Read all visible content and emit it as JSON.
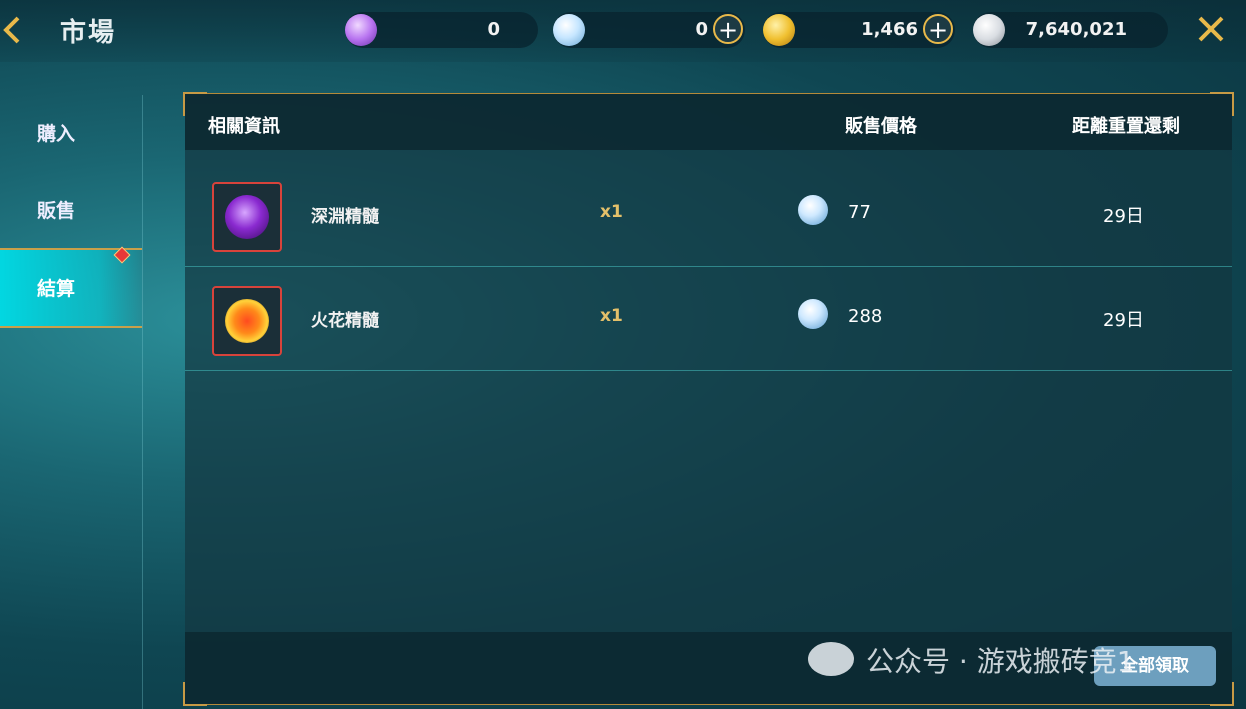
{
  "header": {
    "back_icon": "chevron-left-icon",
    "title": "市場",
    "currencies": [
      {
        "name": "purple-token",
        "icon": "purple-token-icon",
        "value": "0",
        "has_plus": false
      },
      {
        "name": "crystal",
        "icon": "crystal-coin-icon",
        "value": "0",
        "has_plus": true
      },
      {
        "name": "gold",
        "icon": "gold-coin-icon",
        "value": "1,466",
        "has_plus": true
      },
      {
        "name": "silver",
        "icon": "silver-coin-icon",
        "value": "7,640,021",
        "has_plus": false
      }
    ],
    "close_icon": "close-x-icon"
  },
  "sidebar": {
    "items": [
      {
        "label": "購入"
      },
      {
        "label": "販售"
      },
      {
        "label": "結算",
        "active": true
      }
    ]
  },
  "table": {
    "headers": {
      "info": "相關資訊",
      "price": "販售價格",
      "reset": "距離重置還剩"
    },
    "rows": [
      {
        "name": "深淵精髓",
        "qty": "x1",
        "price": "77",
        "days": "29日",
        "icon": "purple-essence-icon"
      },
      {
        "name": "火花精髓",
        "qty": "x1",
        "price": "288",
        "days": "29日",
        "icon": "fire-essence-icon"
      }
    ]
  },
  "footer": {
    "claim_all": "全部領取"
  },
  "watermark": "公众号 · 游戏搬砖竞1",
  "colors": {
    "accent_gold": "#e8b94a",
    "active_tab": "#00dce6",
    "badge_red": "#e63838"
  }
}
